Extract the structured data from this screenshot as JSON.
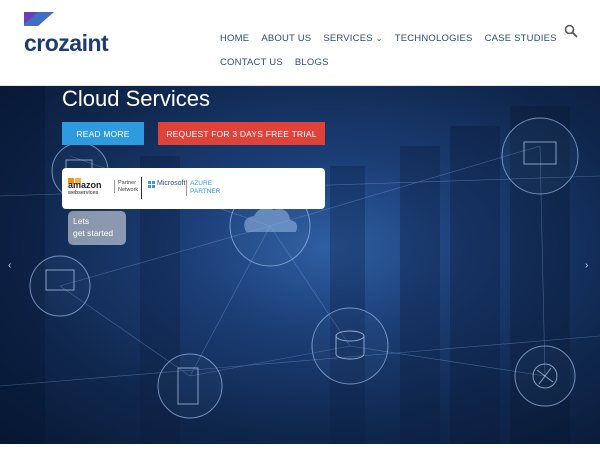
{
  "brand": {
    "name": "crozaint",
    "color": "#1f3b73"
  },
  "nav": {
    "row1": [
      "HOME",
      "ABOUT US",
      "SERVICES",
      "TECHNOLOGIES",
      "CASE STUDIES"
    ],
    "row2": [
      "CONTACT US",
      "BLOGS"
    ],
    "services_has_dropdown": true,
    "color": "#2b4a8a"
  },
  "header_icons": {
    "search": "search-icon"
  },
  "hero": {
    "title": "Cloud Services",
    "read_more": "READ MORE",
    "trial": "REQUEST FOR 3 DAYS FREE TRIAL",
    "read_more_color": "#2e9ae0",
    "trial_color": "#e0423a",
    "partners": {
      "aws_word": "amazon",
      "aws_sub": "webservices",
      "aws_partner": [
        "Partner",
        "Network"
      ],
      "ms_name": "Microsoft",
      "azure": [
        "AZURE",
        "PARTNER"
      ]
    },
    "lets_get_started": [
      "Lets",
      "get started"
    ],
    "prev_icon": "chevron-left-icon",
    "next_icon": "chevron-right-icon"
  }
}
